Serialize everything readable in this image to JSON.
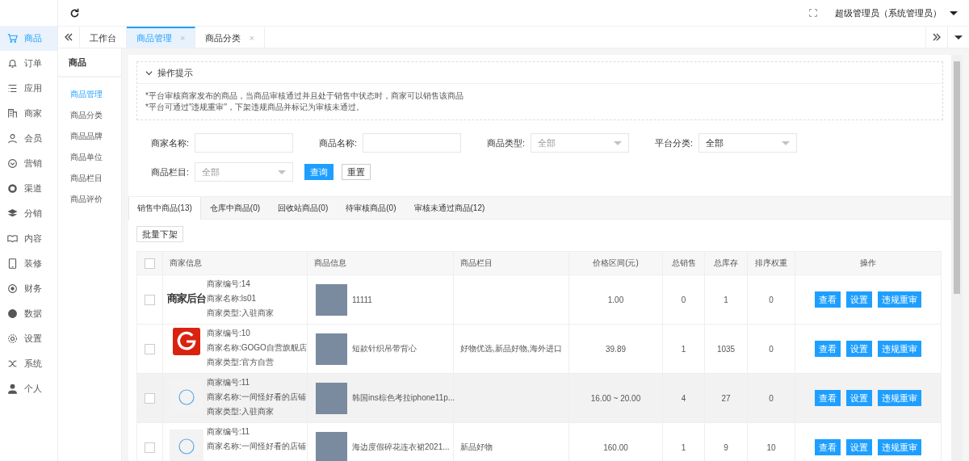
{
  "nav": {
    "items": [
      {
        "label": "商品",
        "selected": true
      },
      {
        "label": "订单",
        "selected": false
      },
      {
        "label": "应用",
        "selected": false
      },
      {
        "label": "商家",
        "selected": false
      },
      {
        "label": "会员",
        "selected": false
      },
      {
        "label": "营销",
        "selected": false
      },
      {
        "label": "渠道",
        "selected": false
      },
      {
        "label": "分销",
        "selected": false
      },
      {
        "label": "内容",
        "selected": false
      },
      {
        "label": "装修",
        "selected": false
      },
      {
        "label": "财务",
        "selected": false
      },
      {
        "label": "数据",
        "selected": false
      },
      {
        "label": "设置",
        "selected": false
      },
      {
        "label": "系统",
        "selected": false
      },
      {
        "label": "个人",
        "selected": false
      }
    ]
  },
  "header": {
    "user": "超级管理员（系统管理员）"
  },
  "tabs": [
    {
      "label": "工作台",
      "selected": false
    },
    {
      "label": "商品管理",
      "selected": true,
      "close": "×"
    },
    {
      "label": "商品分类",
      "selected": false,
      "close": "×"
    }
  ],
  "subnav": {
    "title": "商品",
    "items": [
      {
        "label": "商品管理",
        "selected": true
      },
      {
        "label": "商品分类",
        "selected": false
      },
      {
        "label": "商品品牌",
        "selected": false
      },
      {
        "label": "商品单位",
        "selected": false
      },
      {
        "label": "商品栏目",
        "selected": false
      },
      {
        "label": "商品评价",
        "selected": false
      }
    ]
  },
  "tips": {
    "title": "操作提示",
    "expanded": true,
    "lines": [
      "*平台审核商家发布的商品，当商品审核通过并且处于销售中状态时，商家可以销售该商品",
      "*平台可通过\"违规重审\"，下架违规商品并标记为审核未通过。"
    ]
  },
  "filters": [
    {
      "label": "商家名称:",
      "kind": "input"
    },
    {
      "label": "商品名称:",
      "kind": "input"
    },
    {
      "label": "商品类型:",
      "kind": "select",
      "placeholder": "全部"
    },
    {
      "label": "平台分类:",
      "kind": "select",
      "value": "全部"
    },
    {
      "label": "商品栏目:",
      "kind": "select",
      "placeholder": "全部"
    }
  ],
  "filter_buttons": [
    {
      "label": "查询",
      "kind": "primary"
    },
    {
      "label": "重置",
      "kind": "default"
    }
  ],
  "list_tabs": [
    {
      "label": "销售中商品(13)",
      "selected": true
    },
    {
      "label": "仓库中商品(0)",
      "selected": false
    },
    {
      "label": "回收站商品(0)",
      "selected": false
    },
    {
      "label": "待审核商品(0)",
      "selected": false
    },
    {
      "label": "审核未通过商品(12)",
      "selected": false
    }
  ],
  "batch_button": "批量下架",
  "table": {
    "columns": [
      "商家信息",
      "商品信息",
      "商品栏目",
      "价格区间(元)",
      "总销售",
      "总库存",
      "排序权重",
      "操作"
    ],
    "select_all_checked": false,
    "rows": [
      {
        "checked": false,
        "hovered": false,
        "logo": {
          "kind": "text",
          "text": "商家后台"
        },
        "merchant_lines": [
          "商家编号:14",
          "商家名称:ls01",
          "商家类型:入驻商家"
        ],
        "product": "11111",
        "column": "",
        "price": "1.00",
        "sales": "0",
        "stock": "1",
        "weight": "0",
        "actions": [
          "查看",
          "设置",
          "违规重审"
        ]
      },
      {
        "checked": false,
        "hovered": false,
        "logo": {
          "kind": "g"
        },
        "merchant_lines": [
          "商家编号:10",
          "商家名称:GOGO自营旗舰店",
          "商家类型:官方自营"
        ],
        "product": "短款针织吊带背心",
        "column": "好物优选,新品好物,海外进口",
        "price": "39.89",
        "sales": "1",
        "stock": "1035",
        "weight": "0",
        "actions": [
          "查看",
          "设置",
          "违规重审"
        ]
      },
      {
        "checked": false,
        "hovered": true,
        "logo": {
          "kind": "circle"
        },
        "merchant_lines": [
          "商家编号:11",
          "商家名称:一间怪好看的店铺",
          "商家类型:入驻商家"
        ],
        "product": "韩国ins棕色考拉iphone11p...",
        "column": "",
        "price": "16.00 ~ 20.00",
        "sales": "4",
        "stock": "27",
        "weight": "0",
        "actions": [
          "查看",
          "设置",
          "违规重审"
        ]
      },
      {
        "checked": false,
        "hovered": false,
        "logo": {
          "kind": "circle"
        },
        "merchant_lines": [
          "商家编号:11",
          "商家名称:一间怪好看的店铺"
        ],
        "product": "海边度假碎花连衣裙2021...",
        "column": "新品好物",
        "price": "160.00",
        "sales": "1",
        "stock": "9",
        "weight": "10",
        "actions": [
          "查看",
          "设置",
          "违规重审"
        ]
      }
    ]
  }
}
